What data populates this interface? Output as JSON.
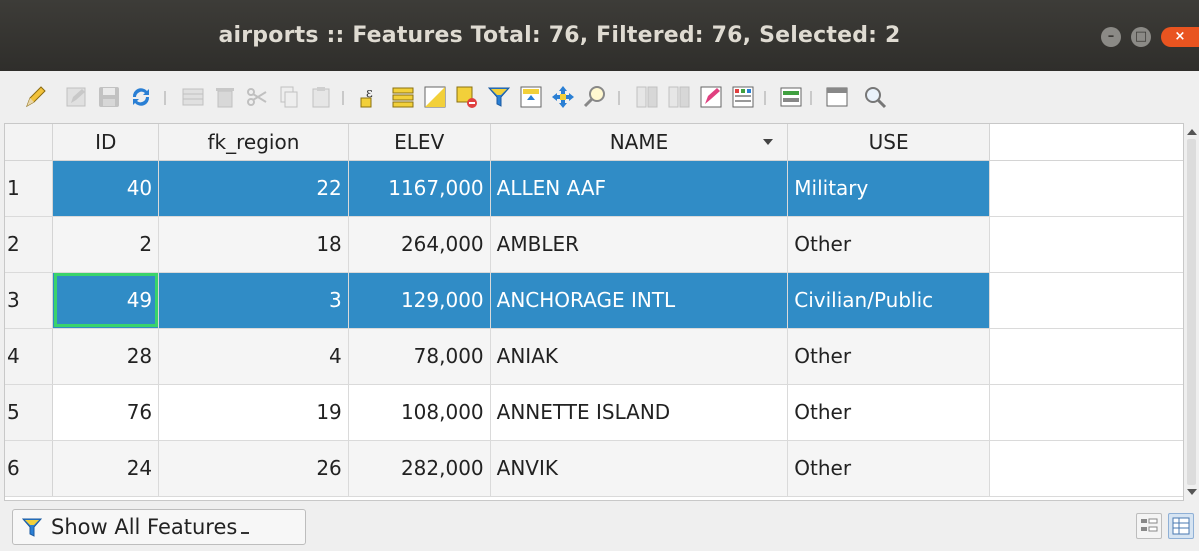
{
  "window": {
    "title": "airports :: Features Total: 76, Filtered: 76, Selected: 2",
    "controls": {
      "minimize": "–",
      "maximize": "□",
      "close": "×"
    }
  },
  "toolbar": {
    "icons": [
      "toggle-editing-icon",
      "save-edits-icon",
      "reload-icon",
      "add-feature-icon",
      "delete-feature-icon",
      "cut-icon",
      "copy-icon",
      "paste-icon",
      "select-by-expression-icon",
      "select-all-icon",
      "invert-selection-icon",
      "deselect-all-icon",
      "filter-select-icon",
      "move-selection-to-top-icon",
      "pan-to-selection-icon",
      "zoom-to-selection-icon",
      "new-field-icon",
      "delete-field-icon",
      "field-calculator-icon",
      "conditional-formatting-icon",
      "actions-icon",
      "dock-icon",
      "zoom-map-icon"
    ]
  },
  "table": {
    "columns": [
      "ID",
      "fk_region",
      "ELEV",
      "NAME",
      "USE"
    ],
    "sorted_column": "NAME",
    "rows": [
      {
        "n": "1",
        "id": "40",
        "fk_region": "22",
        "elev": "1167,000",
        "name": "ALLEN AAF",
        "use": "Military",
        "selected": true
      },
      {
        "n": "2",
        "id": "2",
        "fk_region": "18",
        "elev": "264,000",
        "name": "AMBLER",
        "use": "Other",
        "selected": false
      },
      {
        "n": "3",
        "id": "49",
        "fk_region": "3",
        "elev": "129,000",
        "name": "ANCHORAGE INTL",
        "use": "Civilian/Public",
        "selected": true
      },
      {
        "n": "4",
        "id": "28",
        "fk_region": "4",
        "elev": "78,000",
        "name": "ANIAK",
        "use": "Other",
        "selected": false
      },
      {
        "n": "5",
        "id": "76",
        "fk_region": "19",
        "elev": "108,000",
        "name": "ANNETTE ISLAND",
        "use": "Other",
        "selected": false
      },
      {
        "n": "6",
        "id": "24",
        "fk_region": "26",
        "elev": "282,000",
        "name": "ANVIK",
        "use": "Other",
        "selected": false
      }
    ]
  },
  "footer": {
    "filter_label": "Show All Features"
  },
  "colors": {
    "selection": "#308cc6",
    "current_cell": "#3ad36b",
    "titlebar": "#3d3c38",
    "close_button": "#e95420"
  }
}
